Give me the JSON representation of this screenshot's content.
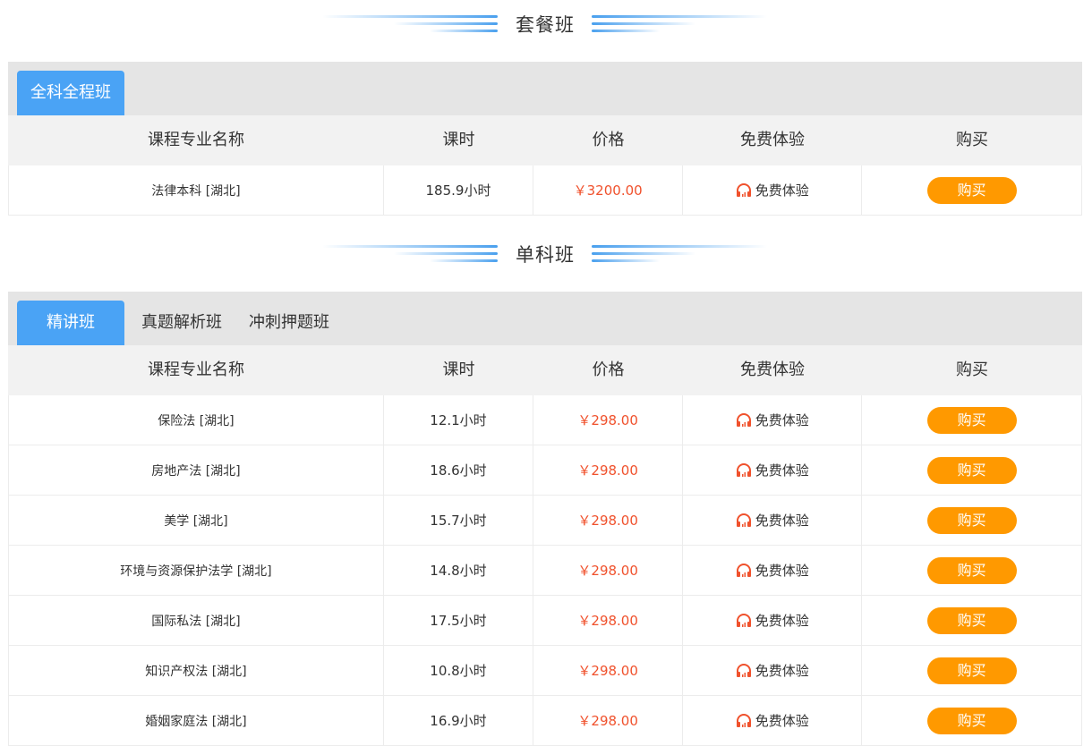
{
  "sections": [
    {
      "title": "套餐班",
      "tabs": [
        {
          "label": "全科全程班",
          "active": true
        }
      ],
      "columns": [
        "课程专业名称",
        "课时",
        "价格",
        "免费体验",
        "购买"
      ],
      "rows": [
        {
          "name": "法律本科 [湖北]",
          "hours": "185.9小时",
          "price": "￥3200.00",
          "trial": "免费体验",
          "buy": "购买"
        }
      ]
    },
    {
      "title": "单科班",
      "tabs": [
        {
          "label": "精讲班",
          "active": true
        },
        {
          "label": "真题解析班",
          "active": false
        },
        {
          "label": "冲刺押题班",
          "active": false
        }
      ],
      "columns": [
        "课程专业名称",
        "课时",
        "价格",
        "免费体验",
        "购买"
      ],
      "rows": [
        {
          "name": "保险法 [湖北]",
          "hours": "12.1小时",
          "price": "￥298.00",
          "trial": "免费体验",
          "buy": "购买"
        },
        {
          "name": "房地产法 [湖北]",
          "hours": "18.6小时",
          "price": "￥298.00",
          "trial": "免费体验",
          "buy": "购买"
        },
        {
          "name": "美学 [湖北]",
          "hours": "15.7小时",
          "price": "￥298.00",
          "trial": "免费体验",
          "buy": "购买"
        },
        {
          "name": "环境与资源保护法学 [湖北]",
          "hours": "14.8小时",
          "price": "￥298.00",
          "trial": "免费体验",
          "buy": "购买"
        },
        {
          "name": "国际私法 [湖北]",
          "hours": "17.5小时",
          "price": "￥298.00",
          "trial": "免费体验",
          "buy": "购买"
        },
        {
          "name": "知识产权法 [湖北]",
          "hours": "10.8小时",
          "price": "￥298.00",
          "trial": "免费体验",
          "buy": "购买"
        },
        {
          "name": "婚姻家庭法 [湖北]",
          "hours": "16.9小时",
          "price": "￥298.00",
          "trial": "免费体验",
          "buy": "购买"
        }
      ]
    }
  ],
  "colors": {
    "accent": "#4aa3f5",
    "price": "#f0512c",
    "buy": "#ff9900",
    "headphone": "#f0512c"
  },
  "icons": {
    "trial": "headphone-icon"
  }
}
